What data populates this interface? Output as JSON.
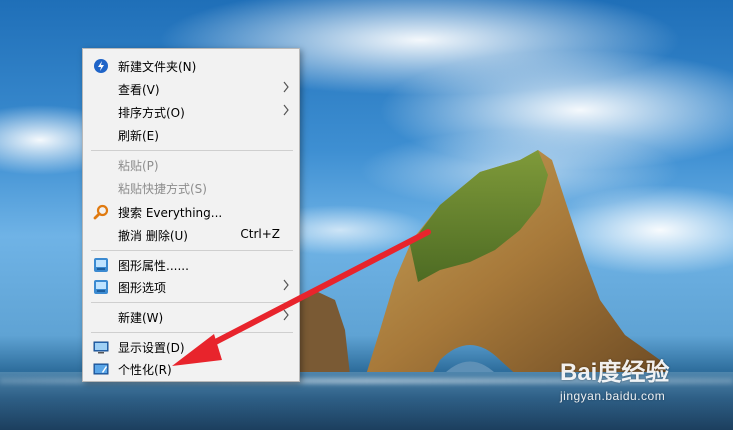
{
  "context_menu": {
    "items": [
      {
        "label": "新建文件夹(N)",
        "icon": "everything-folder-icon"
      },
      {
        "label": "查看(V)",
        "submenu": true
      },
      {
        "label": "排序方式(O)",
        "submenu": true
      },
      {
        "label": "刷新(E)"
      },
      {
        "label": "粘贴(P)",
        "disabled": true
      },
      {
        "label": "粘贴快捷方式(S)",
        "disabled": true
      },
      {
        "label": "搜索 Everything...",
        "icon": "search-icon"
      },
      {
        "label": "撤消 删除(U)",
        "shortcut": "Ctrl+Z"
      },
      {
        "label": "图形属性......",
        "icon": "graphics-icon"
      },
      {
        "label": "图形选项",
        "icon": "graphics-icon",
        "submenu": true
      },
      {
        "label": "新建(W)",
        "submenu": true
      },
      {
        "label": "显示设置(D)",
        "icon": "display-icon"
      },
      {
        "label": "个性化(R)",
        "icon": "personalize-icon"
      }
    ]
  },
  "annotation": {
    "arrow_color": "#e8242c",
    "points_to": "个性化(R)"
  },
  "watermark": {
    "brand": "Bai度经验",
    "url": "jingyan.baidu.com"
  }
}
